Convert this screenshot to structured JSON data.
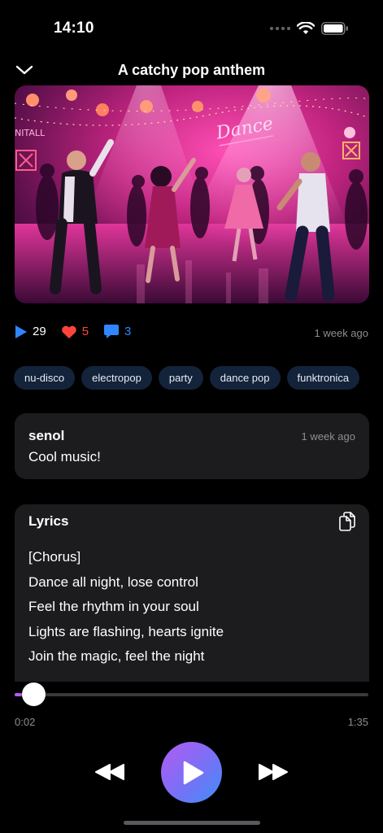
{
  "status_bar": {
    "time": "14:10"
  },
  "header": {
    "title": "A catchy pop anthem"
  },
  "cover": {
    "sign_text": "Dance"
  },
  "stats": {
    "plays": "29",
    "likes": "5",
    "comments": "3",
    "posted": "1 week ago",
    "colors": {
      "plays": "#2f86ff",
      "likes": "#ff453a",
      "comments": "#2f86ff"
    }
  },
  "tags": [
    "nu-disco",
    "electropop",
    "party",
    "dance pop",
    "funktronica"
  ],
  "comment": {
    "user": "senol",
    "time": "1 week ago",
    "text": "Cool music!"
  },
  "lyrics": {
    "title": "Lyrics",
    "lines": [
      "[Chorus]",
      "Dance all night, lose control",
      "Feel the rhythm in your soul",
      "Lights are flashing, hearts ignite",
      "Join the magic, feel the night"
    ]
  },
  "player": {
    "current_time": "0:02",
    "total_time": "1:35",
    "progress": 0.021,
    "accent": "#b35cff"
  },
  "icons": [
    "chevron-down-icon",
    "play-count-icon",
    "heart-icon",
    "comment-icon",
    "copy-icon",
    "rewind-icon",
    "play-icon",
    "fast-forward-icon"
  ]
}
